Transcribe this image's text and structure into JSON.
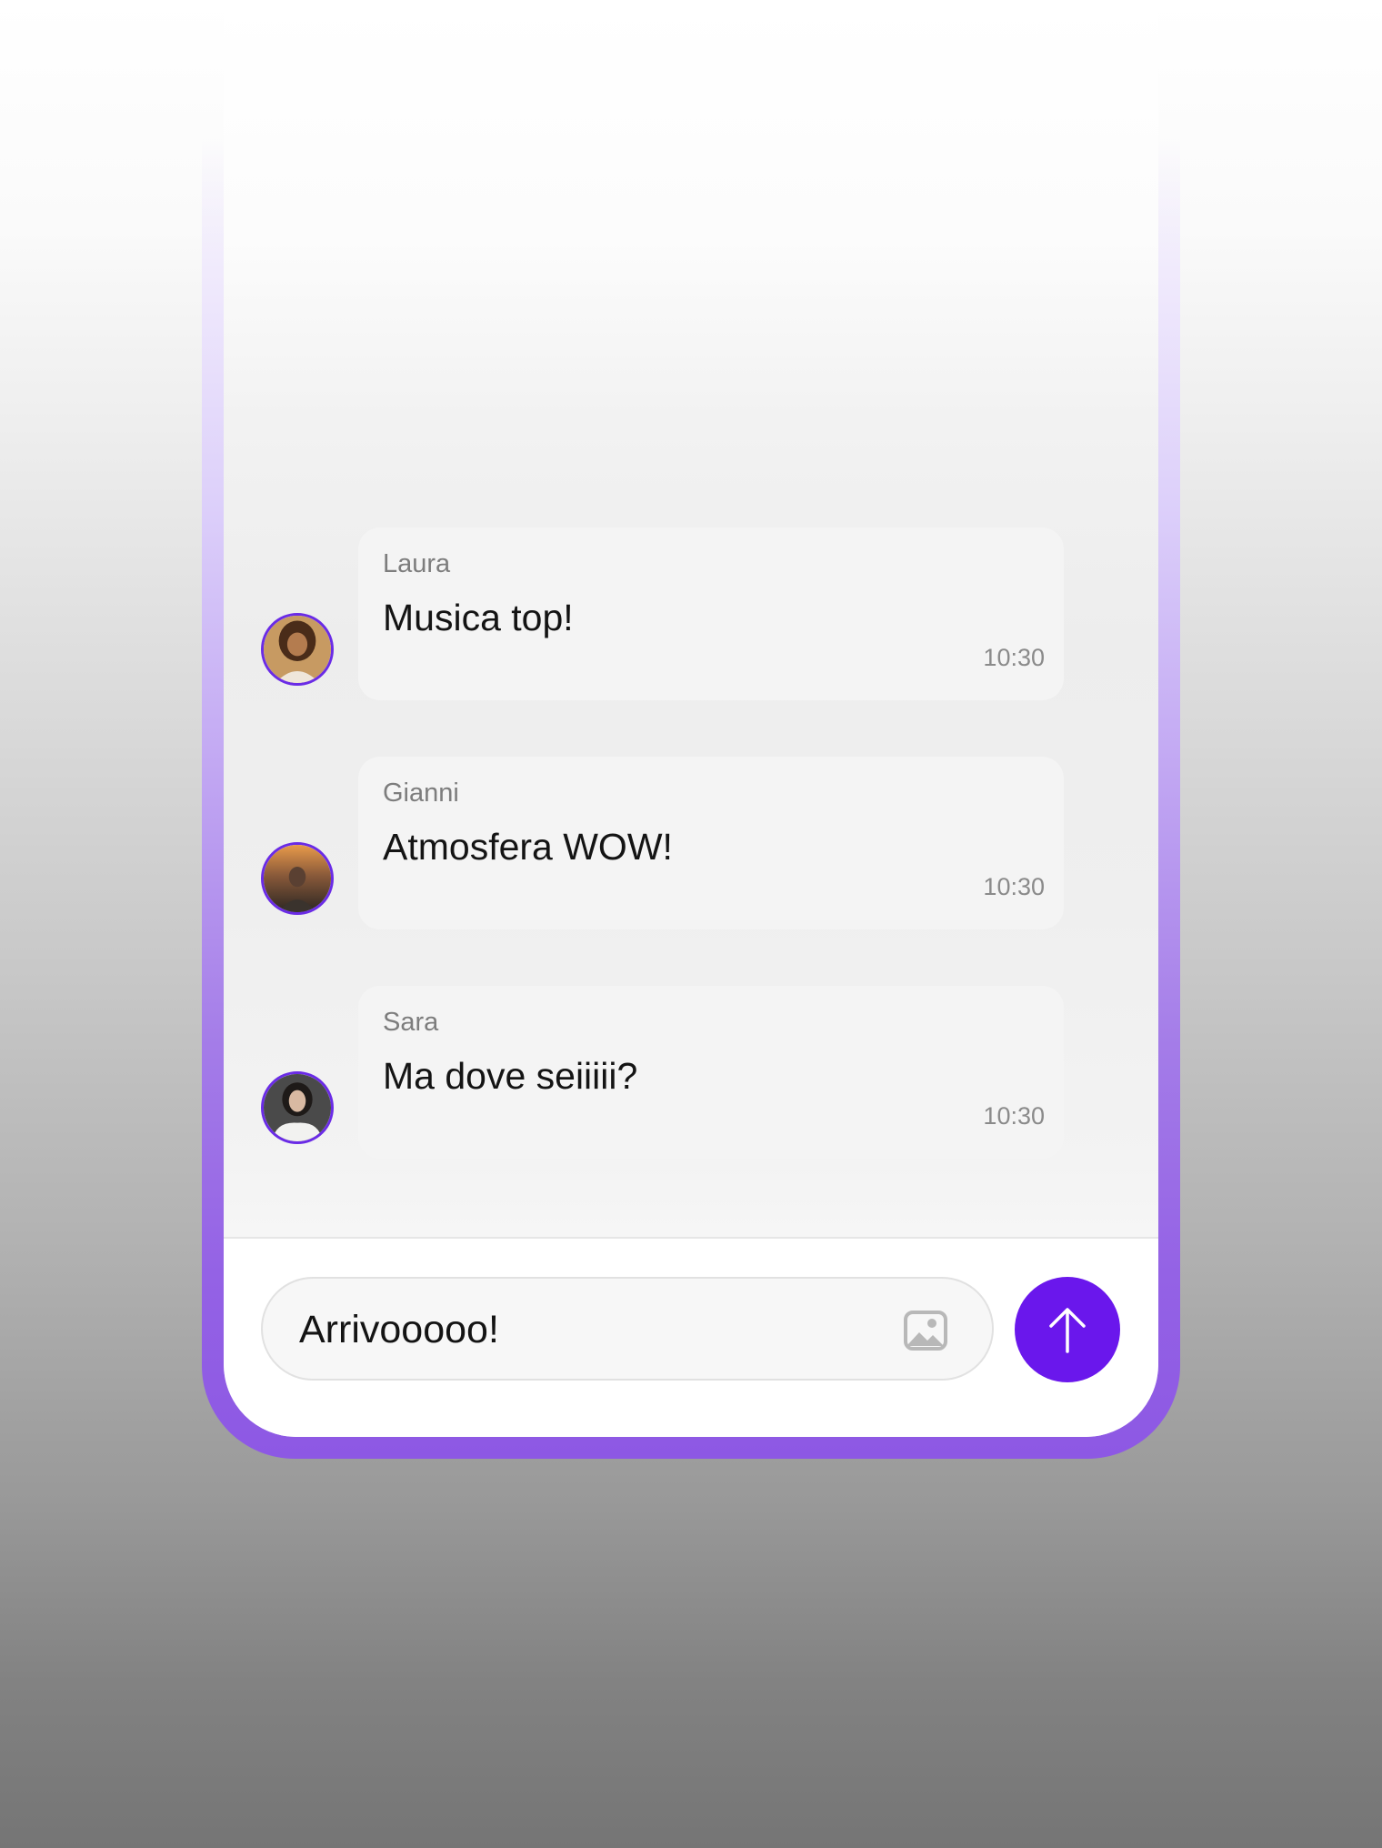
{
  "chat": {
    "messages": [
      {
        "sender": "Laura",
        "text": "Musica top!",
        "time": "10:30",
        "avatar": "avatar-laura"
      },
      {
        "sender": "Gianni",
        "text": "Atmosfera WOW!",
        "time": "10:30",
        "avatar": "avatar-gianni"
      },
      {
        "sender": "Sara",
        "text": "Ma dove seiiiii?",
        "time": "10:30",
        "avatar": "avatar-sara"
      }
    ]
  },
  "composer": {
    "input_value": "Arrivooooo!",
    "attach_icon": "image-icon",
    "send_icon": "arrow-up-icon"
  },
  "colors": {
    "accent": "#6a17ec",
    "avatar_ring": "#6a2be6",
    "frame_bottom": "#8d58e4",
    "bubble": "#f4f4f4"
  }
}
